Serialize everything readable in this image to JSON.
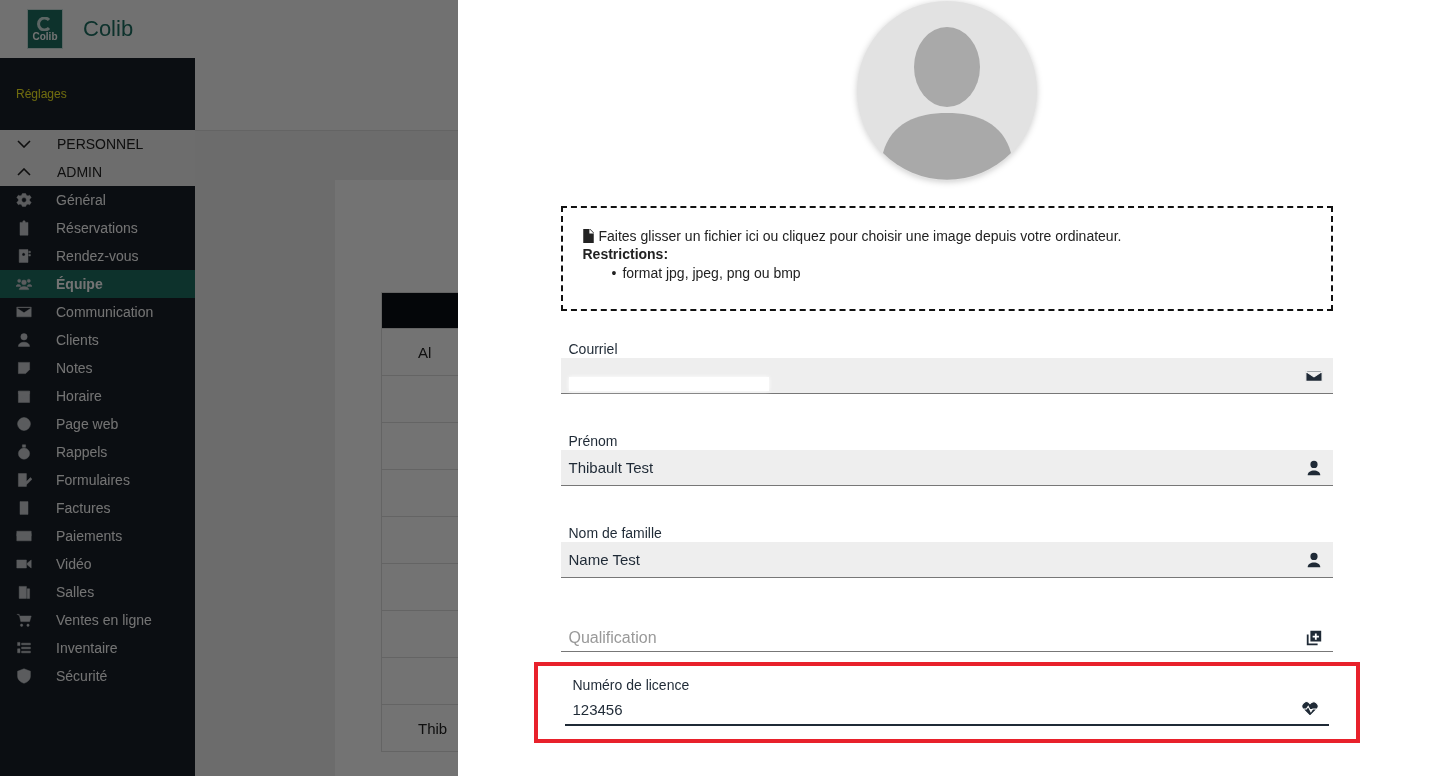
{
  "header": {
    "logo_text": "Colib",
    "brand": "Colib"
  },
  "sidebar": {
    "title": "Réglages",
    "sections": [
      {
        "label": "PERSONNEL",
        "expanded": false
      },
      {
        "label": "ADMIN",
        "expanded": true
      }
    ],
    "items": [
      {
        "label": "Général",
        "selected": false
      },
      {
        "label": "Réservations",
        "selected": false
      },
      {
        "label": "Rendez-vous",
        "selected": false
      },
      {
        "label": "Équipe",
        "selected": true
      },
      {
        "label": "Communication",
        "selected": false
      },
      {
        "label": "Clients",
        "selected": false
      },
      {
        "label": "Notes",
        "selected": false
      },
      {
        "label": "Horaire",
        "selected": false
      },
      {
        "label": "Page web",
        "selected": false
      },
      {
        "label": "Rappels",
        "selected": false
      },
      {
        "label": "Formulaires",
        "selected": false
      },
      {
        "label": "Factures",
        "selected": false
      },
      {
        "label": "Paiements",
        "selected": false
      },
      {
        "label": "Vidéo",
        "selected": false
      },
      {
        "label": "Salles",
        "selected": false
      },
      {
        "label": "Ventes en ligne",
        "selected": false
      },
      {
        "label": "Inventaire",
        "selected": false
      },
      {
        "label": "Sécurité",
        "selected": false
      }
    ]
  },
  "background_table": {
    "first_row": "Al",
    "last_row": "Thib"
  },
  "profile_form": {
    "dropzone": {
      "text": "Faites glisser un fichier ici ou cliquez pour choisir une image depuis votre ordinateur.",
      "restrictions_title": "Restrictions:",
      "restrictions": [
        {
          "bullet": "•",
          "text": "format jpg, jpeg, png ou bmp"
        }
      ]
    },
    "fields": [
      {
        "label": "Courriel",
        "redacted": true,
        "highlighted": false
      },
      {
        "label": "Prénom",
        "value": "Thibault Test",
        "highlighted": false
      },
      {
        "label": "Nom de famille",
        "value": "Name Test",
        "highlighted": false
      },
      {
        "placeholder": "Qualification",
        "highlighted": false
      },
      {
        "label": "Numéro de licence",
        "value": "123456",
        "highlighted": true
      }
    ]
  }
}
